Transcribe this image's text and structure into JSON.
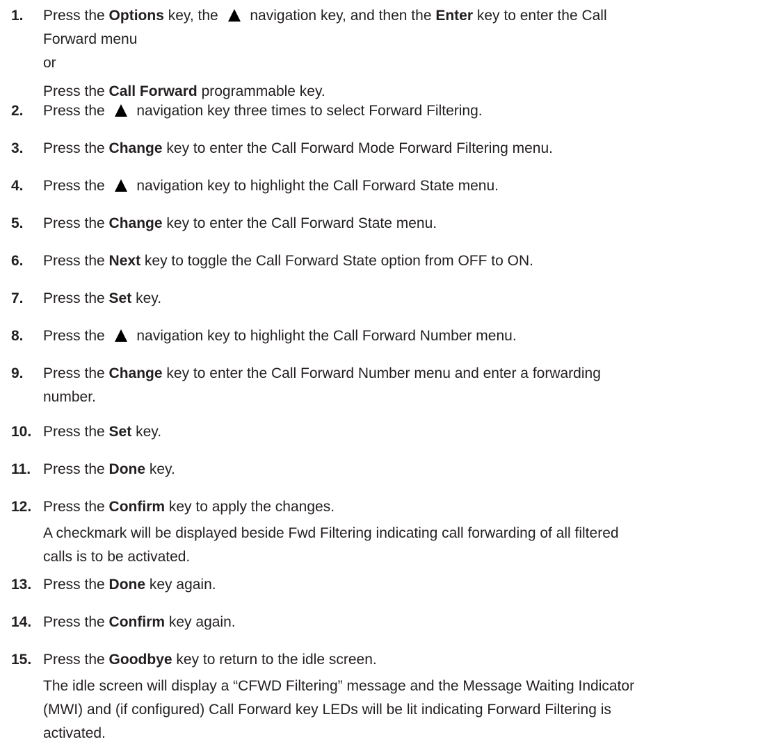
{
  "steps": [
    {
      "num": "1.",
      "lines": [
        [
          {
            "t": "Press the "
          },
          {
            "t": "Options",
            "b": true
          },
          {
            "t": " key, the "
          },
          {
            "icon": "up-arrow-icon"
          },
          {
            "t": " navigation key, and then the "
          },
          {
            "t": "Enter",
            "b": true
          },
          {
            "t": " key to enter the Call"
          }
        ],
        [
          {
            "t": "Forward menu"
          }
        ],
        [
          {
            "t": "or"
          }
        ],
        [
          {
            "t": "Press the "
          },
          {
            "t": "Call Forward",
            "b": true
          },
          {
            "t": " programmable key."
          }
        ]
      ]
    },
    {
      "num": "2.",
      "lines": [
        [
          {
            "t": "Press the "
          },
          {
            "icon": "up-arrow-icon"
          },
          {
            "t": " navigation key three times to select Forward Filtering."
          }
        ]
      ]
    },
    {
      "num": "3.",
      "lines": [
        [
          {
            "t": "Press the "
          },
          {
            "t": "Change",
            "b": true
          },
          {
            "t": " key to enter the Call Forward Mode Forward Filtering menu."
          }
        ]
      ]
    },
    {
      "num": "4.",
      "lines": [
        [
          {
            "t": "Press the "
          },
          {
            "icon": "up-arrow-icon"
          },
          {
            "t": " navigation key to highlight the Call Forward State menu."
          }
        ]
      ]
    },
    {
      "num": "5.",
      "lines": [
        [
          {
            "t": "Press the "
          },
          {
            "t": "Change",
            "b": true
          },
          {
            "t": " key to enter the Call Forward State menu."
          }
        ]
      ]
    },
    {
      "num": "6.",
      "lines": [
        [
          {
            "t": "Press the "
          },
          {
            "t": "Next",
            "b": true
          },
          {
            "t": " key to toggle the Call Forward State option from OFF to ON."
          }
        ]
      ]
    },
    {
      "num": "7.",
      "lines": [
        [
          {
            "t": "Press the "
          },
          {
            "t": "Set",
            "b": true
          },
          {
            "t": " key."
          }
        ]
      ]
    },
    {
      "num": "8.",
      "lines": [
        [
          {
            "t": "Press the "
          },
          {
            "icon": "up-arrow-icon"
          },
          {
            "t": " navigation key to highlight the Call Forward Number menu."
          }
        ]
      ]
    },
    {
      "num": "9.",
      "lines": [
        [
          {
            "t": "Press the "
          },
          {
            "t": "Change",
            "b": true
          },
          {
            "t": " key to enter the Call Forward Number menu and enter a forwarding"
          }
        ],
        [
          {
            "t": "number."
          }
        ]
      ]
    },
    {
      "num": "10.",
      "lines": [
        [
          {
            "t": "Press the "
          },
          {
            "t": "Set",
            "b": true
          },
          {
            "t": " key."
          }
        ]
      ]
    },
    {
      "num": "11.",
      "lines": [
        [
          {
            "t": "Press the "
          },
          {
            "t": "Done",
            "b": true
          },
          {
            "t": " key."
          }
        ]
      ]
    },
    {
      "num": "12.",
      "lines": [
        [
          {
            "t": "Press the "
          },
          {
            "t": "Confirm",
            "b": true
          },
          {
            "t": " key to apply the changes."
          }
        ],
        [
          {
            "t": "A checkmark will be displayed beside Fwd Filtering indicating call forwarding of all filtered"
          }
        ],
        [
          {
            "t": "calls is to be activated."
          }
        ]
      ]
    },
    {
      "num": "13.",
      "lines": [
        [
          {
            "t": "Press the "
          },
          {
            "t": "Done",
            "b": true
          },
          {
            "t": " key again."
          }
        ]
      ]
    },
    {
      "num": "14.",
      "lines": [
        [
          {
            "t": "Press the "
          },
          {
            "t": "Confirm",
            "b": true
          },
          {
            "t": " key again."
          }
        ]
      ]
    },
    {
      "num": "15.",
      "lines": [
        [
          {
            "t": "Press the "
          },
          {
            "t": "Goodbye",
            "b": true
          },
          {
            "t": " key to return to the idle screen."
          }
        ],
        [
          {
            "t": "The idle screen will display a “CFWD Filtering” message and the Message Waiting Indicator"
          }
        ],
        [
          {
            "t": "(MWI) and (if configured) Call Forward key LEDs will be lit indicating Forward Filtering is"
          }
        ],
        [
          {
            "t": "activated."
          }
        ]
      ]
    }
  ]
}
